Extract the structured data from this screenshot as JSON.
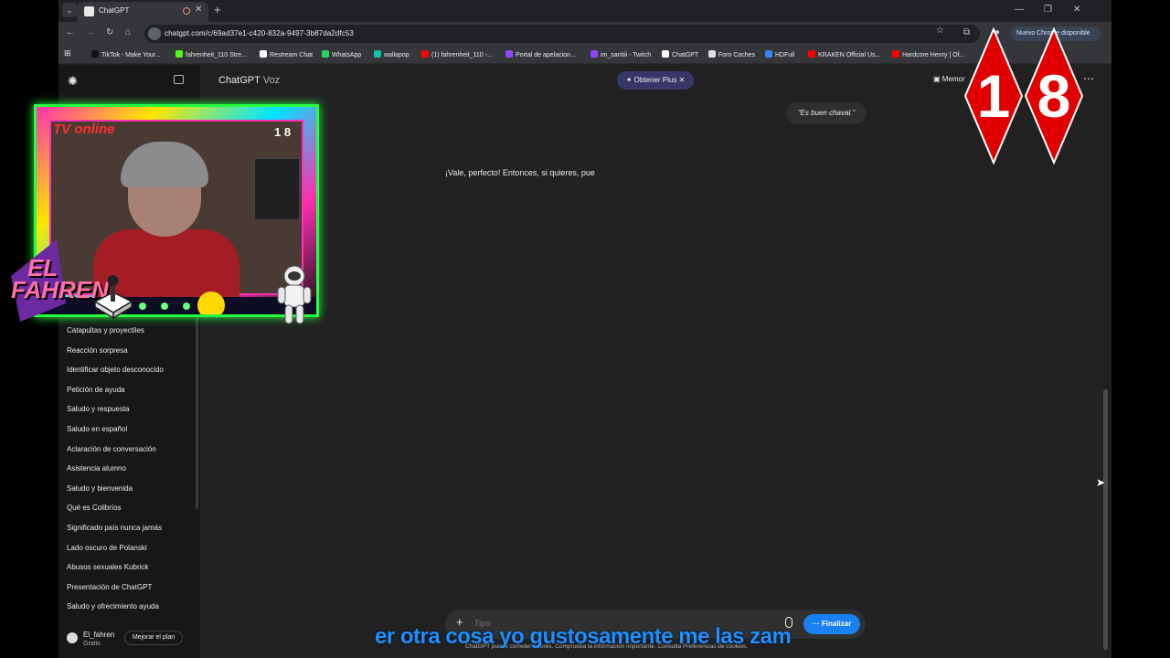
{
  "browser": {
    "tab_title": "ChatGPT",
    "url": "chatgpt.com/c/69ad37e1-c420-832a-9497-3b87da2dfc53",
    "update_label": "Nuevo Chrome disponible",
    "bookmarks": [
      {
        "label": "TikTok - Make Your...",
        "color": "#111111"
      },
      {
        "label": "fahrenheit_110 Stre...",
        "color": "#53fc18"
      },
      {
        "label": "Restream Chat",
        "color": "#ffffff"
      },
      {
        "label": "WhatsApp",
        "color": "#25d366"
      },
      {
        "label": "wallapop",
        "color": "#13c1ac"
      },
      {
        "label": "(1) fahrenheit_110 -...",
        "color": "#ff0000"
      },
      {
        "label": "Portal de apelacion...",
        "color": "#9146ff"
      },
      {
        "label": "im_santiii - Twitch",
        "color": "#9146ff"
      },
      {
        "label": "ChatGPT",
        "color": "#ffffff"
      },
      {
        "label": "Foro Coches",
        "color": "#dddddd"
      },
      {
        "label": "HDFull",
        "color": "#3b82f6"
      },
      {
        "label": "KRAKEN Official Us...",
        "color": "#ff0000"
      },
      {
        "label": "Hardcore Henry | Of...",
        "color": "#ff0000"
      }
    ]
  },
  "chatgpt": {
    "title": "ChatGPT",
    "title_suffix": "Voz",
    "plus_label": "Obtener Plus",
    "memory_label": "Memor",
    "user_message": "\"Es buen chaval.\"",
    "assistant_message": "¡Vale, perfecto! Entonces, si quieres, pue",
    "composer_placeholder": "Tipo",
    "finish_label": "Finalizar",
    "disclaimer": "ChatGPT puede cometer errores. Comprueba la información importante. Consulta Preferencias de cookies."
  },
  "sidebar": {
    "history": [
      "Catapultas y proyectiles",
      "Reacción sorpresa",
      "Identificar objeto desconocido",
      "Petición de ayuda",
      "Saludo y respuesta",
      "Saludo en español",
      "Aclaración de conversación",
      "Asistencia alumno",
      "Saludo y bienvenida",
      "Qué es Colibríos",
      "Significado país nunca jamás",
      "Lado oscuro de Polanski",
      "Abusos sexuales Kubrick",
      "Presentación de ChatGPT",
      "Saludo y ofrecimiento ayuda"
    ],
    "user_name": "El_fahren",
    "user_plan": "Gratis",
    "upgrade_label": "Mejorar el plan"
  },
  "overlay": {
    "cam_label": "TV online",
    "cam_badge": "1 8",
    "logo_line1": "EL",
    "logo_line2": "FAHREN",
    "age_digit1": "1",
    "age_digit2": "8",
    "subtitle": "er otra cosa yo gustosamente me las zam"
  }
}
